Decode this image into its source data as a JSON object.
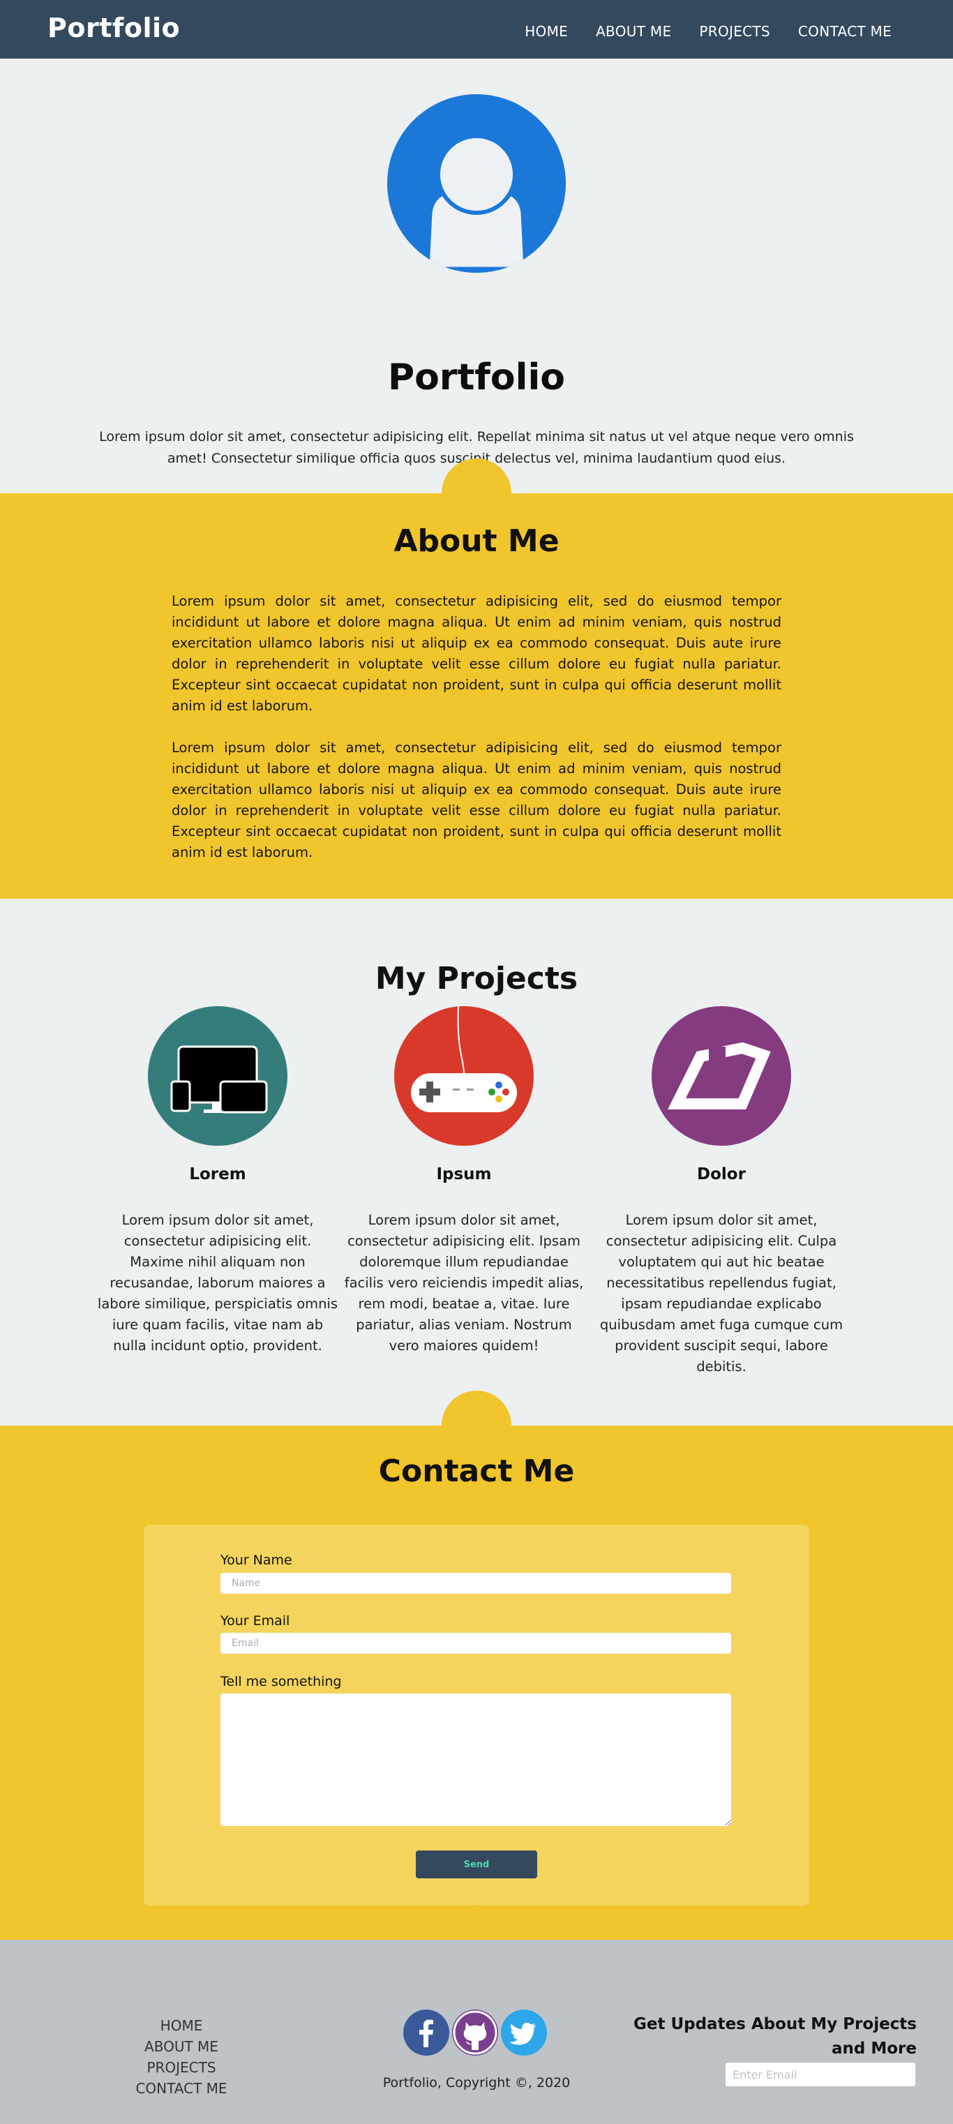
{
  "navbar": {
    "brand": "Portfolio",
    "links": [
      "HOME",
      "ABOUT ME",
      "PROJECTS",
      "CONTACT ME"
    ]
  },
  "hero": {
    "avatar_icon": "user-avatar-icon",
    "title": "Portfolio",
    "text": "Lorem ipsum dolor sit amet, consectetur adipisicing elit. Repellat minima sit natus ut vel atque neque vero omnis amet! Consectetur similique officia quos suscipit delectus vel, minima laudantium quod eius."
  },
  "about": {
    "title": "About Me",
    "paragraphs": [
      "Lorem ipsum dolor sit amet, consectetur adipisicing elit, sed do eiusmod tempor incididunt ut labore et dolore magna aliqua. Ut enim ad minim veniam, quis nostrud exercitation ullamco laboris nisi ut aliquip ex ea commodo consequat. Duis aute irure dolor in reprehenderit in voluptate velit esse cillum dolore eu fugiat nulla pariatur. Excepteur sint occaecat cupidatat non proident, sunt in culpa qui officia deserunt mollit anim id est laborum.",
      "Lorem ipsum dolor sit amet, consectetur adipisicing elit, sed do eiusmod tempor incididunt ut labore et dolore magna aliqua. Ut enim ad minim veniam, quis nostrud exercitation ullamco laboris nisi ut aliquip ex ea commodo consequat. Duis aute irure dolor in reprehenderit in voluptate velit esse cillum dolore eu fugiat nulla pariatur. Excepteur sint occaecat cupidatat non proident, sunt in culpa qui officia deserunt mollit anim id est laborum."
    ]
  },
  "projects": {
    "title": "My Projects",
    "items": [
      {
        "name": "Lorem",
        "icon": "devices-icon",
        "color": "#357d7b",
        "desc": "Lorem ipsum dolor sit amet, consectetur adipisicing elit. Maxime nihil aliquam non recusandae, laborum maiores a labore similique, perspiciatis omnis iure quam facilis, vitae nam ab nulla incidunt optio, provident."
      },
      {
        "name": "Ipsum",
        "icon": "gamepad-icon",
        "color": "#d9392a",
        "desc": "Lorem ipsum dolor sit amet, consectetur adipisicing elit. Ipsam doloremque illum repudiandae facilis vero reiciendis impedit alias, rem modi, beatae a, vitae. Iure pariatur, alias veniam. Nostrum vero maiores quidem!"
      },
      {
        "name": "Dolor",
        "icon": "parallelogram-logo-icon",
        "color": "#843b80",
        "desc": "Lorem ipsum dolor sit amet, consectetur adipisicing elit. Culpa voluptatem qui aut hic beatae necessitatibus repellendus fugiat, ipsam repudiandae explicabo quibusdam amet fuga cumque cum provident suscipit sequi, labore debitis."
      }
    ]
  },
  "contact": {
    "title": "Contact Me",
    "name_label": "Your Name",
    "name_placeholder": "Name",
    "email_label": "Your Email",
    "email_placeholder": "Email",
    "message_label": "Tell me something",
    "send_label": "Send"
  },
  "footer": {
    "links": [
      "HOME",
      "ABOUT ME",
      "PROJECTS",
      "CONTACT ME"
    ],
    "social": [
      {
        "icon": "facebook-icon",
        "color": "#3b5998"
      },
      {
        "icon": "github-icon",
        "color": "#7a3f8f"
      },
      {
        "icon": "twitter-icon",
        "color": "#2da7e9"
      }
    ],
    "copyright": "Portfolio, Copyright ©, 2020",
    "updates_title": "Get Updates About My Projects and More",
    "updates_placeholder": "Enter Email"
  },
  "colors": {
    "navbar": "#34495e",
    "light_bg": "#ecf0f1",
    "accent_yellow": "#f1c52c",
    "form_card": "#f4d45c",
    "footer_bg": "#bdc3c7",
    "send_text": "#4fd8b0"
  }
}
